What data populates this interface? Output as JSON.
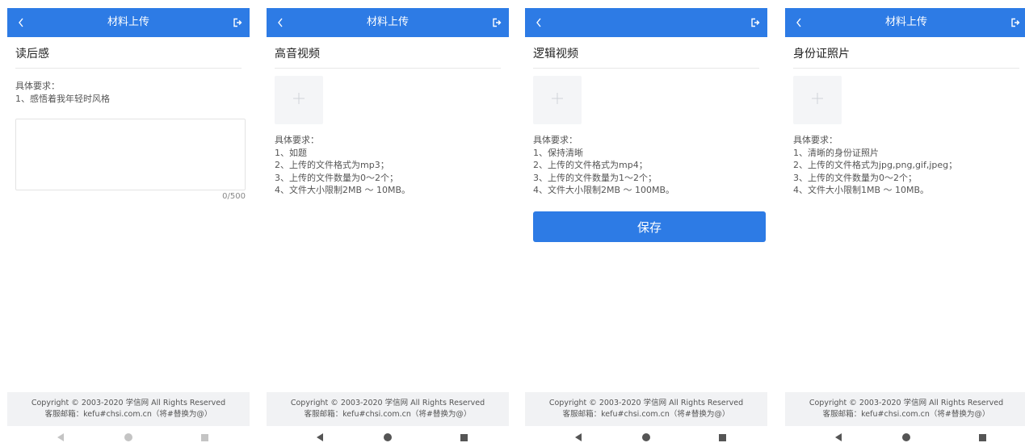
{
  "screens": [
    {
      "header": {
        "title": "材料上传"
      },
      "section_title": "读后感",
      "requirements": [
        "具体要求：",
        "1、感悟着我年轻时风格"
      ],
      "textarea": {
        "value": "",
        "counter": "0/500"
      }
    },
    {
      "header": {
        "title": "材料上传"
      },
      "section_title": "高音视频",
      "requirements": [
        "具体要求：",
        "1、如题",
        "2、上传的文件格式为mp3；",
        "3、上传的文件数量为0～2个；",
        "4、文件大小限制2MB ～ 10MB。"
      ]
    },
    {
      "header": {
        "title": ""
      },
      "section_title": "逻辑视频",
      "requirements": [
        "具体要求：",
        "1、保持清晰",
        "2、上传的文件格式为mp4；",
        "3、上传的文件数量为1～2个；",
        "4、文件大小限制2MB ～ 100MB。"
      ],
      "save_label": "保存"
    },
    {
      "header": {
        "title": "材料上传"
      },
      "section_title": "身份证照片",
      "requirements": [
        "具体要求：",
        "1、清晰的身份证照片",
        "2、上传的文件格式为jpg,png,gif,jpeg；",
        "3、上传的文件数量为0～2个；",
        "4、文件大小限制1MB ～ 10MB。"
      ]
    }
  ],
  "footer": {
    "copyright": "Copyright © 2003-2020 学信网 All Rights Reserved",
    "email": "客服邮箱：kefu#chsi.com.cn（将#替换为@）"
  },
  "icons": {
    "back": "chevron-left-icon",
    "exit": "logout-icon",
    "upload": "plus-icon",
    "nav": [
      "back-triangle-icon",
      "home-circle-icon",
      "recent-square-icon"
    ]
  },
  "colors": {
    "accent": "#2d7be5",
    "footer_bg": "#f1f2f4",
    "upload_bg": "#f4f5f7"
  }
}
